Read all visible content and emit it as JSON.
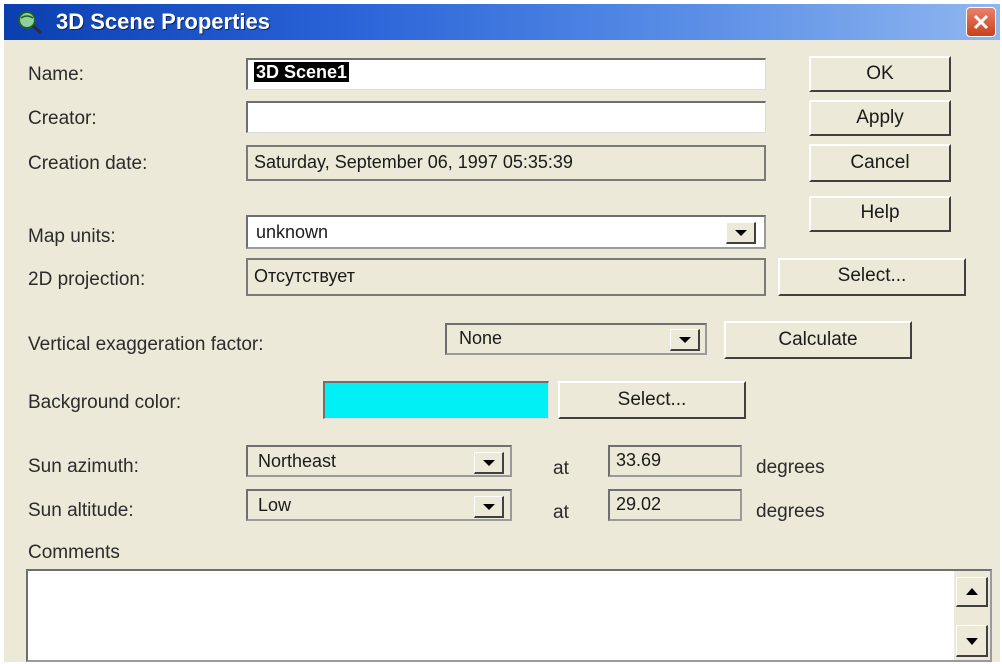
{
  "window": {
    "title": "3D Scene Properties",
    "title_icon": "globe-magnifier-icon",
    "close_icon": "close-icon"
  },
  "fields": {
    "name_label": "Name:",
    "name_value": "3D Scene1",
    "creator_label": "Creator:",
    "creator_value": "",
    "creation_date_label": "Creation date:",
    "creation_date_value": "Saturday, September 06, 1997 05:35:39",
    "map_units_label": "Map units:",
    "map_units_value": "unknown",
    "projection_label": "2D projection:",
    "projection_value": "Отсутствует",
    "vertical_exaggeration_label": "Vertical exaggeration factor:",
    "vertical_exaggeration_value": "None",
    "background_color_label": "Background color:",
    "background_color": "#00f0f5",
    "sun_azimuth_label": "Sun azimuth:",
    "sun_azimuth_value": "Northeast",
    "sun_azimuth_at": "at",
    "sun_azimuth_degrees": "33.69",
    "sun_azimuth_unit": "degrees",
    "sun_altitude_label": "Sun altitude:",
    "sun_altitude_value": "Low",
    "sun_altitude_at": "at",
    "sun_altitude_degrees": "29.02",
    "sun_altitude_unit": "degrees",
    "comments_label": "Comments",
    "comments_value": ""
  },
  "buttons": {
    "ok": "OK",
    "apply": "Apply",
    "cancel": "Cancel",
    "help": "Help",
    "select_projection": "Select...",
    "calculate": "Calculate",
    "select_color": "Select..."
  },
  "colors": {
    "title_bar": "#2a64d8",
    "dialog_background": "#ece9d8",
    "close_button": "#d2542f"
  }
}
